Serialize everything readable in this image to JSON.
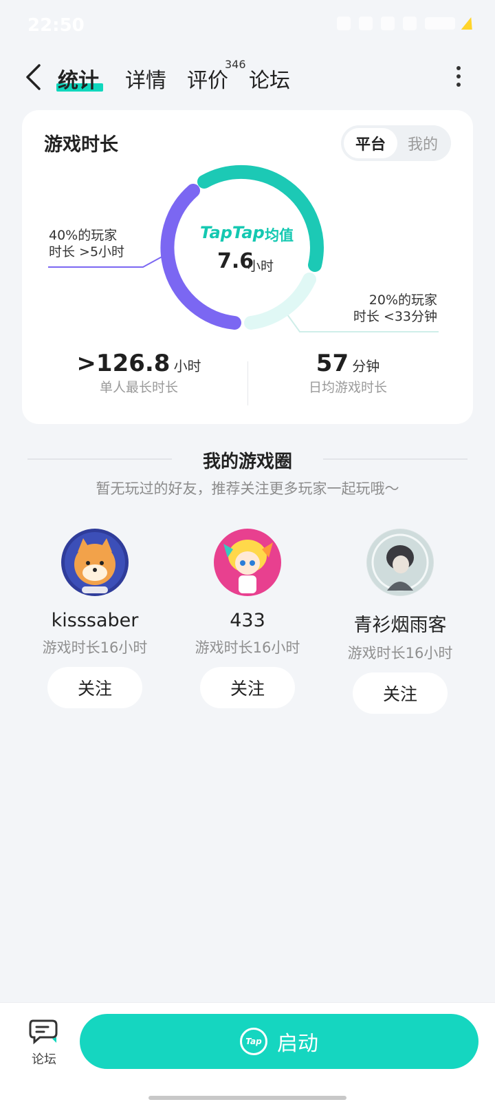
{
  "status_bar": {
    "time": "22:50"
  },
  "header": {
    "tabs": [
      {
        "label": "统计"
      },
      {
        "label": "详情"
      },
      {
        "label": "评价",
        "badge": "346"
      },
      {
        "label": "论坛"
      }
    ],
    "active_tab": "统计"
  },
  "stats_card": {
    "title": "游戏时长",
    "toggle": {
      "options": [
        "平台",
        "我的"
      ],
      "selected": "平台"
    },
    "donut": {
      "brand": "TapTap",
      "avg_label": "均值",
      "value": "7.6",
      "unit": "小时",
      "left_annotation": [
        "40%的玩家",
        "时长 >5小时"
      ],
      "right_annotation": [
        "20%的玩家",
        "时长 <33分钟"
      ],
      "segments": [
        {
          "share_percent": 40,
          "color": "#7b67f2"
        },
        {
          "share_percent": 40,
          "color": "#1cc9b5"
        },
        {
          "share_percent": 20,
          "color": "#e0f8f5"
        }
      ]
    },
    "stats": [
      {
        "value": ">126.8",
        "unit": "小时",
        "label": "单人最长时长"
      },
      {
        "value": "57",
        "unit": "分钟",
        "label": "日均游戏时长"
      }
    ]
  },
  "game_circle": {
    "title": "我的游戏圈",
    "subtitle": "暂无玩过的好友，推荐关注更多玩家一起玩哦～",
    "friends": [
      {
        "name": "kisssaber",
        "playtime": "游戏时长16小时",
        "follow_label": "关注",
        "avatar": "shiba-dog-avatar"
      },
      {
        "name": "433",
        "playtime": "游戏时长16小时",
        "follow_label": "关注",
        "avatar": "anime-girl-avatar"
      },
      {
        "name": "青衫烟雨客",
        "playtime": "游戏时长16小时",
        "follow_label": "关注",
        "avatar": "dark-hair-character-avatar"
      }
    ]
  },
  "bottom_bar": {
    "forum_label": "论坛",
    "launch_label": "启动",
    "launch_icon_text": "Tap"
  }
}
